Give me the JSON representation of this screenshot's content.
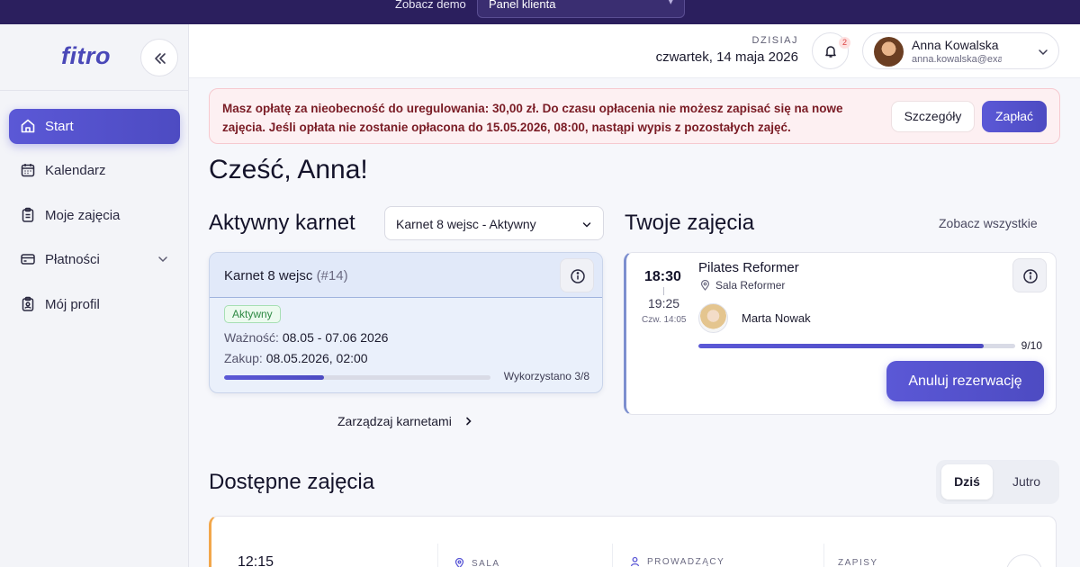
{
  "demo_bar": {
    "label": "Zobacz demo",
    "select_value": "Panel klienta"
  },
  "sidebar": {
    "logo": "fitro",
    "items": [
      {
        "label": "Start",
        "icon": "home-icon",
        "active": true
      },
      {
        "label": "Kalendarz",
        "icon": "calendar-icon"
      },
      {
        "label": "Moje zajęcia",
        "icon": "clipboard-icon"
      },
      {
        "label": "Płatności",
        "icon": "card-icon",
        "expandable": true
      },
      {
        "label": "Mój profil",
        "icon": "profile-icon"
      }
    ]
  },
  "header": {
    "today_label": "DZISIAJ",
    "today_date": "czwartek, 14 maja 2026",
    "notifications_count": "2",
    "user_name": "Anna Kowalska",
    "user_email": "anna.kowalska@exam..."
  },
  "alert": {
    "message": "Masz opłatę za nieobecność do uregulowania: 30,00 zł. Do czasu opłacenia nie możesz zapisać się na nowe zajęcia. Jeśli opłata nie zostanie opłacona do 15.05.2026, 08:00, nastąpi wypis z pozostałych zajęć.",
    "details_label": "Szczegóły",
    "pay_label": "Zapłać"
  },
  "greeting": "Cześć, Anna!",
  "active_pass": {
    "title": "Aktywny karnet",
    "select_value": "Karnet 8 wejsc - Aktywny",
    "card_title": "Karnet 8 wejsc",
    "card_number": "(#14)",
    "status": "Aktywny",
    "validity_label": "Ważność:",
    "validity_value": "08.05 - 07.06 2026",
    "purchase_label": "Zakup:",
    "purchase_value": "08.05.2026, 02:00",
    "used_text": "Wykorzystano 3/8",
    "used": 3,
    "total": 8,
    "manage_label": "Zarządzaj karnetami"
  },
  "your_classes": {
    "title": "Twoje zajęcia",
    "see_all_label": "Zobacz wszystkie",
    "class": {
      "start": "18:30",
      "end": "19:25",
      "date": "Czw. 14:05",
      "name": "Pilates Reformer",
      "room": "Sala Reformer",
      "coach": "Marta Nowak",
      "capacity_text": "9/10",
      "booked": 9,
      "capacity": 10,
      "cancel_label": "Anuluj rezerwację"
    }
  },
  "available_classes": {
    "title": "Dostępne zajęcia",
    "today_label": "Dziś",
    "tomorrow_label": "Jutro",
    "first_time": "12:15",
    "col_room": "SALA",
    "col_coach": "PROWADZĄCY",
    "col_signups": "ZAPISY"
  },
  "colors": {
    "accent": "#5b58d6",
    "sidebar_bg": "#f3f4f8",
    "alert_bg": "#fdf0f2",
    "alert_text": "#7a1c25"
  }
}
